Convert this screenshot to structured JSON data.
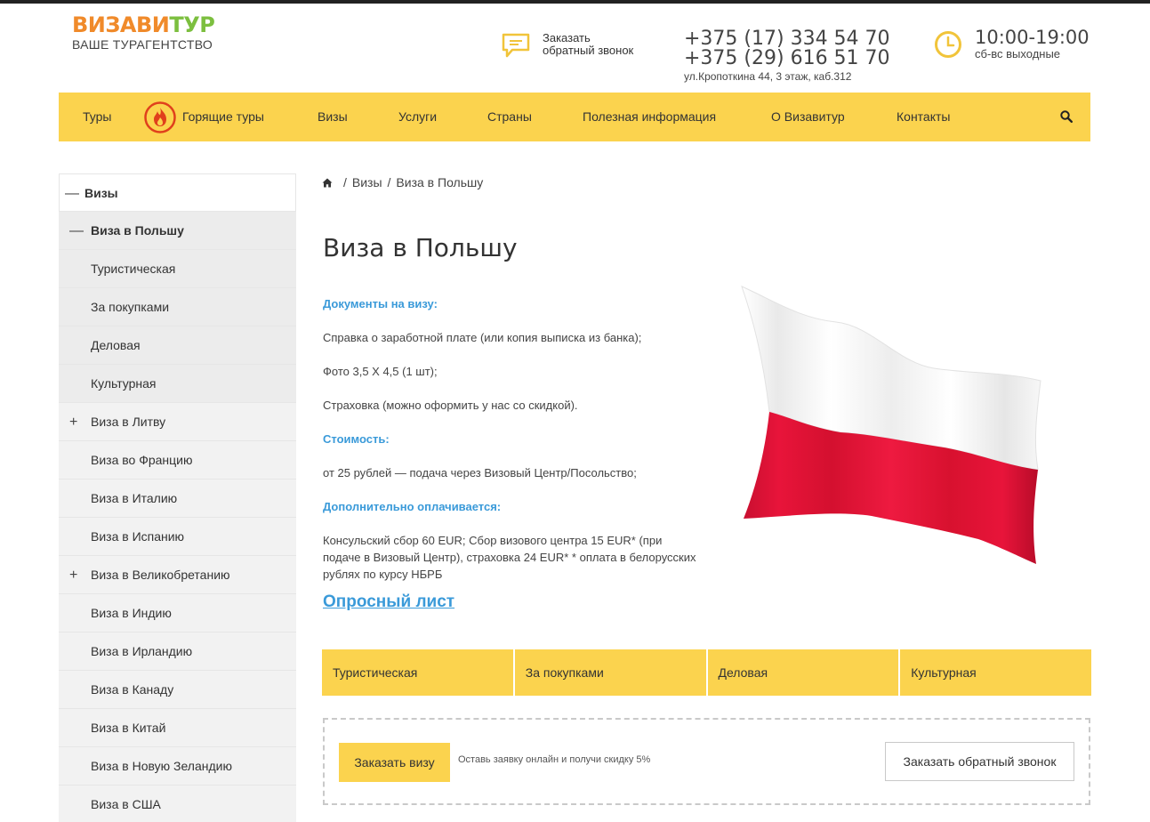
{
  "header": {
    "logo_part1": "ВИЗАВИ",
    "logo_part2": "ТУР",
    "logo_sub": "ВАШЕ ТУРАГЕНТСТВО",
    "callback_line1": "Заказать",
    "callback_line2": "обратный звонок",
    "phone1": "+375 (17) 334 54 70",
    "phone2": "+375 (29) 616 51 70",
    "address": "ул.Кропоткина 44, 3 этаж, каб.312",
    "hours": "10:00-19:00",
    "hours_note": "сб-вс выходные"
  },
  "nav": {
    "tours": "Туры",
    "hot_tours": "Горящие туры",
    "visas": "Визы",
    "services": "Услуги",
    "countries": "Страны",
    "useful": "Полезная информация",
    "about": "О Визавитур",
    "contacts": "Контакты"
  },
  "sidebar": {
    "root": "Визы",
    "active": "Виза в Польшу",
    "subs": [
      "Туристическая",
      "За покупками",
      "Деловая",
      "Культурная"
    ],
    "items": [
      "Виза в Литву",
      "Виза во Францию",
      "Виза в Италию",
      "Виза в Испанию",
      "Виза в Великобретанию",
      "Виза в Индию",
      "Виза в Ирландию",
      "Виза в Канаду",
      "Виза в Китай",
      "Виза в Новую Зеландию",
      "Виза в США"
    ]
  },
  "breadcrumb": {
    "visas": "Визы",
    "current": "Виза в Польшу"
  },
  "page": {
    "title": "Виза в Польшу",
    "docs_heading": "Документы на визу:",
    "doc1": "Справка о заработной плате (или копия выписка из банка);",
    "doc2": "Фото 3,5 Х 4,5 (1 шт);",
    "doc3": "Страховка (можно оформить у нас со скидкой).",
    "cost_heading": "Стоимость:",
    "cost": "от 25 рублей — подача через Визовый Центр/Посольство;",
    "extra_heading": "Дополнительно оплачивается:",
    "extra": "Консульский сбор 60 EUR; Сбор визового центра 15 EUR* (при подаче в Визовый Центр), страховка 24 EUR* * оплата в белорусских рублях по курсу НБРБ",
    "survey": "Опросный лист"
  },
  "tabs": [
    "Туристическая",
    "За покупками",
    "Деловая",
    "Культурная"
  ],
  "cta": {
    "order": "Заказать визу",
    "note": "Оставь заявку онлайн и получи скидку 5%",
    "callback": "Заказать обратный звонок"
  },
  "colors": {
    "accent": "#fbd34e",
    "link": "#3a9ad9",
    "logo_orange": "#f08a2a",
    "logo_green": "#7cbf3f",
    "flag_red": "#e8143a"
  }
}
